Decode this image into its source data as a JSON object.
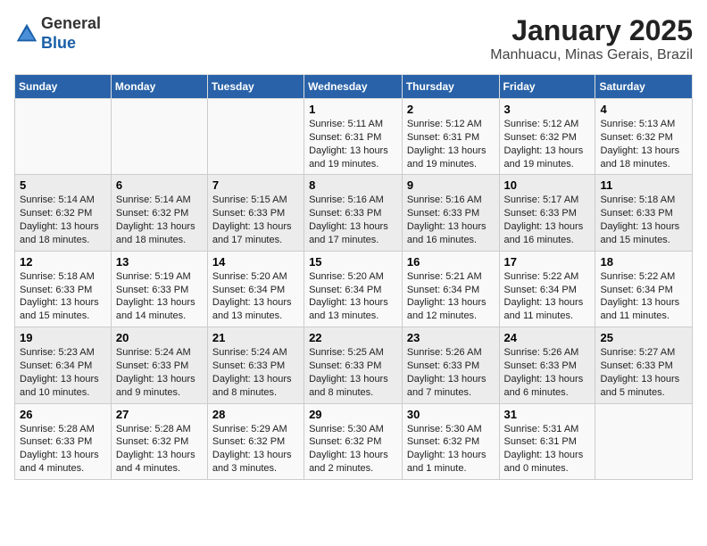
{
  "logo": {
    "general": "General",
    "blue": "Blue"
  },
  "header": {
    "title": "January 2025",
    "subtitle": "Manhuacu, Minas Gerais, Brazil"
  },
  "weekdays": [
    "Sunday",
    "Monday",
    "Tuesday",
    "Wednesday",
    "Thursday",
    "Friday",
    "Saturday"
  ],
  "weeks": [
    [
      {
        "day": "",
        "info": ""
      },
      {
        "day": "",
        "info": ""
      },
      {
        "day": "",
        "info": ""
      },
      {
        "day": "1",
        "info": "Sunrise: 5:11 AM\nSunset: 6:31 PM\nDaylight: 13 hours\nand 19 minutes."
      },
      {
        "day": "2",
        "info": "Sunrise: 5:12 AM\nSunset: 6:31 PM\nDaylight: 13 hours\nand 19 minutes."
      },
      {
        "day": "3",
        "info": "Sunrise: 5:12 AM\nSunset: 6:32 PM\nDaylight: 13 hours\nand 19 minutes."
      },
      {
        "day": "4",
        "info": "Sunrise: 5:13 AM\nSunset: 6:32 PM\nDaylight: 13 hours\nand 18 minutes."
      }
    ],
    [
      {
        "day": "5",
        "info": "Sunrise: 5:14 AM\nSunset: 6:32 PM\nDaylight: 13 hours\nand 18 minutes."
      },
      {
        "day": "6",
        "info": "Sunrise: 5:14 AM\nSunset: 6:32 PM\nDaylight: 13 hours\nand 18 minutes."
      },
      {
        "day": "7",
        "info": "Sunrise: 5:15 AM\nSunset: 6:33 PM\nDaylight: 13 hours\nand 17 minutes."
      },
      {
        "day": "8",
        "info": "Sunrise: 5:16 AM\nSunset: 6:33 PM\nDaylight: 13 hours\nand 17 minutes."
      },
      {
        "day": "9",
        "info": "Sunrise: 5:16 AM\nSunset: 6:33 PM\nDaylight: 13 hours\nand 16 minutes."
      },
      {
        "day": "10",
        "info": "Sunrise: 5:17 AM\nSunset: 6:33 PM\nDaylight: 13 hours\nand 16 minutes."
      },
      {
        "day": "11",
        "info": "Sunrise: 5:18 AM\nSunset: 6:33 PM\nDaylight: 13 hours\nand 15 minutes."
      }
    ],
    [
      {
        "day": "12",
        "info": "Sunrise: 5:18 AM\nSunset: 6:33 PM\nDaylight: 13 hours\nand 15 minutes."
      },
      {
        "day": "13",
        "info": "Sunrise: 5:19 AM\nSunset: 6:33 PM\nDaylight: 13 hours\nand 14 minutes."
      },
      {
        "day": "14",
        "info": "Sunrise: 5:20 AM\nSunset: 6:34 PM\nDaylight: 13 hours\nand 13 minutes."
      },
      {
        "day": "15",
        "info": "Sunrise: 5:20 AM\nSunset: 6:34 PM\nDaylight: 13 hours\nand 13 minutes."
      },
      {
        "day": "16",
        "info": "Sunrise: 5:21 AM\nSunset: 6:34 PM\nDaylight: 13 hours\nand 12 minutes."
      },
      {
        "day": "17",
        "info": "Sunrise: 5:22 AM\nSunset: 6:34 PM\nDaylight: 13 hours\nand 11 minutes."
      },
      {
        "day": "18",
        "info": "Sunrise: 5:22 AM\nSunset: 6:34 PM\nDaylight: 13 hours\nand 11 minutes."
      }
    ],
    [
      {
        "day": "19",
        "info": "Sunrise: 5:23 AM\nSunset: 6:34 PM\nDaylight: 13 hours\nand 10 minutes."
      },
      {
        "day": "20",
        "info": "Sunrise: 5:24 AM\nSunset: 6:33 PM\nDaylight: 13 hours\nand 9 minutes."
      },
      {
        "day": "21",
        "info": "Sunrise: 5:24 AM\nSunset: 6:33 PM\nDaylight: 13 hours\nand 8 minutes."
      },
      {
        "day": "22",
        "info": "Sunrise: 5:25 AM\nSunset: 6:33 PM\nDaylight: 13 hours\nand 8 minutes."
      },
      {
        "day": "23",
        "info": "Sunrise: 5:26 AM\nSunset: 6:33 PM\nDaylight: 13 hours\nand 7 minutes."
      },
      {
        "day": "24",
        "info": "Sunrise: 5:26 AM\nSunset: 6:33 PM\nDaylight: 13 hours\nand 6 minutes."
      },
      {
        "day": "25",
        "info": "Sunrise: 5:27 AM\nSunset: 6:33 PM\nDaylight: 13 hours\nand 5 minutes."
      }
    ],
    [
      {
        "day": "26",
        "info": "Sunrise: 5:28 AM\nSunset: 6:33 PM\nDaylight: 13 hours\nand 4 minutes."
      },
      {
        "day": "27",
        "info": "Sunrise: 5:28 AM\nSunset: 6:32 PM\nDaylight: 13 hours\nand 4 minutes."
      },
      {
        "day": "28",
        "info": "Sunrise: 5:29 AM\nSunset: 6:32 PM\nDaylight: 13 hours\nand 3 minutes."
      },
      {
        "day": "29",
        "info": "Sunrise: 5:30 AM\nSunset: 6:32 PM\nDaylight: 13 hours\nand 2 minutes."
      },
      {
        "day": "30",
        "info": "Sunrise: 5:30 AM\nSunset: 6:32 PM\nDaylight: 13 hours\nand 1 minute."
      },
      {
        "day": "31",
        "info": "Sunrise: 5:31 AM\nSunset: 6:31 PM\nDaylight: 13 hours\nand 0 minutes."
      },
      {
        "day": "",
        "info": ""
      }
    ]
  ]
}
